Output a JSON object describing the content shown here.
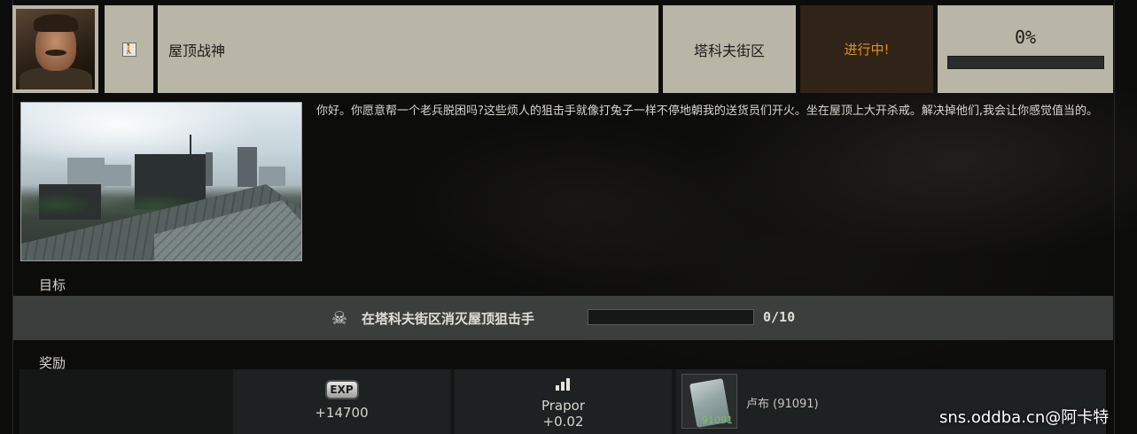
{
  "quest": {
    "title": "屋顶战神",
    "location": "塔科夫街区",
    "status": "进行中!",
    "progress_percent": "0%",
    "progress_fraction": 0,
    "description": "你好。你愿意帮一个老兵脱困吗?这些烦人的狙击手就像打兔子一样不停地朝我的送货员们开火。坐在屋顶上大开杀戒。解决掉他们,我会让你感觉值当的。"
  },
  "sections": {
    "objectives_label": "目标",
    "rewards_label": "奖励"
  },
  "objective": {
    "icon": "skull-icon",
    "text": "在塔科夫街区消灭屋顶狙击手",
    "count": "0/10",
    "fraction": 0
  },
  "rewards": {
    "exp_badge": "EXP",
    "exp_value": "+14700",
    "trader_name": "Prapor",
    "trader_value": "+0.02",
    "item_label": "卢布 (91091)",
    "item_count": "91091"
  },
  "watermark": "sns.oddba.cn@阿卡特",
  "colors": {
    "header_tile": "#bab6a7",
    "status_text": "#e0902c",
    "status_bg": "#2f2417",
    "objective_bar": "#3c3e3e",
    "item_count": "#7fbf5e"
  }
}
